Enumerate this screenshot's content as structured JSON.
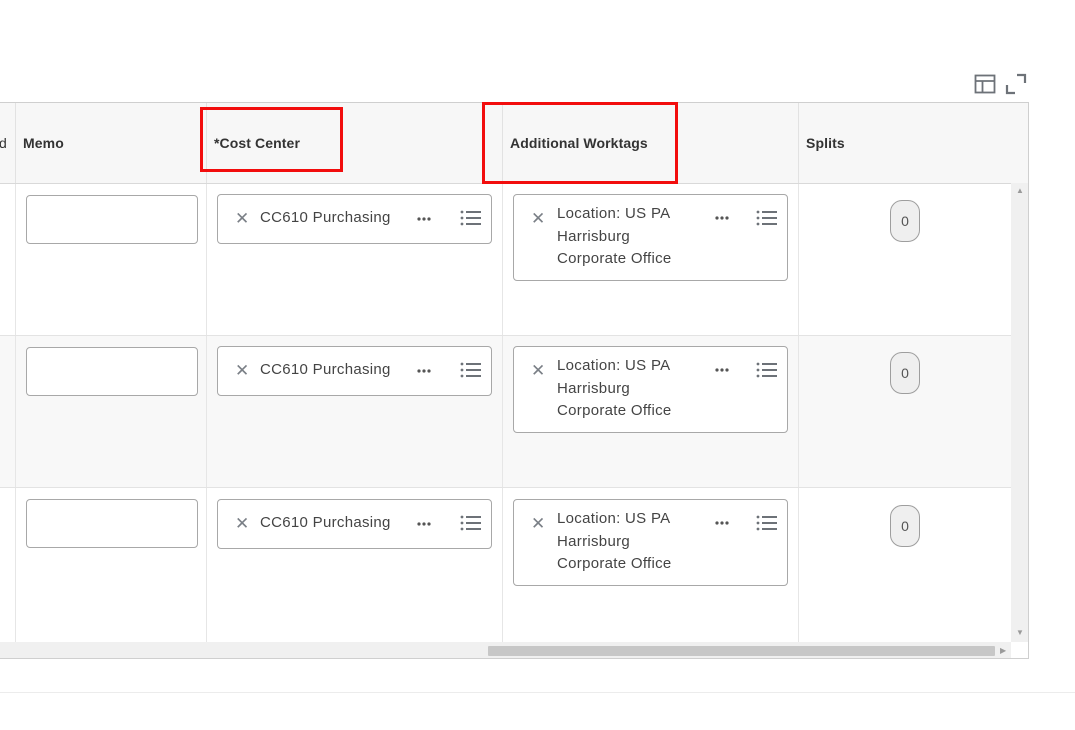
{
  "toolbar": {
    "columns_icon": "table-columns-icon",
    "fullscreen_icon": "expand-icon"
  },
  "columns": {
    "partial_left": "d",
    "memo": "Memo",
    "cost_center": "*Cost Center",
    "additional_worktags": "Additional Worktags",
    "splits": "Splits"
  },
  "rows": [
    {
      "memo": "",
      "cost_center": "CC610 Purchasing",
      "worktag_line1": "Location: US PA",
      "worktag_line2": "Harrisburg",
      "worktag_line3": "Corporate Office",
      "splits": "0"
    },
    {
      "memo": "",
      "cost_center": "CC610 Purchasing",
      "worktag_line1": "Location: US PA",
      "worktag_line2": "Harrisburg",
      "worktag_line3": "Corporate Office",
      "splits": "0"
    },
    {
      "memo": "",
      "cost_center": "CC610 Purchasing",
      "worktag_line1": "Location: US PA",
      "worktag_line2": "Harrisburg",
      "worktag_line3": "Corporate Office",
      "splits": "0"
    }
  ],
  "icons": {
    "remove": "close-icon",
    "related_actions": "ellipsis-icon",
    "prompt_list": "list-icon"
  },
  "colors": {
    "highlight": "#f20d0d",
    "header_bg": "#f7f7f7"
  }
}
